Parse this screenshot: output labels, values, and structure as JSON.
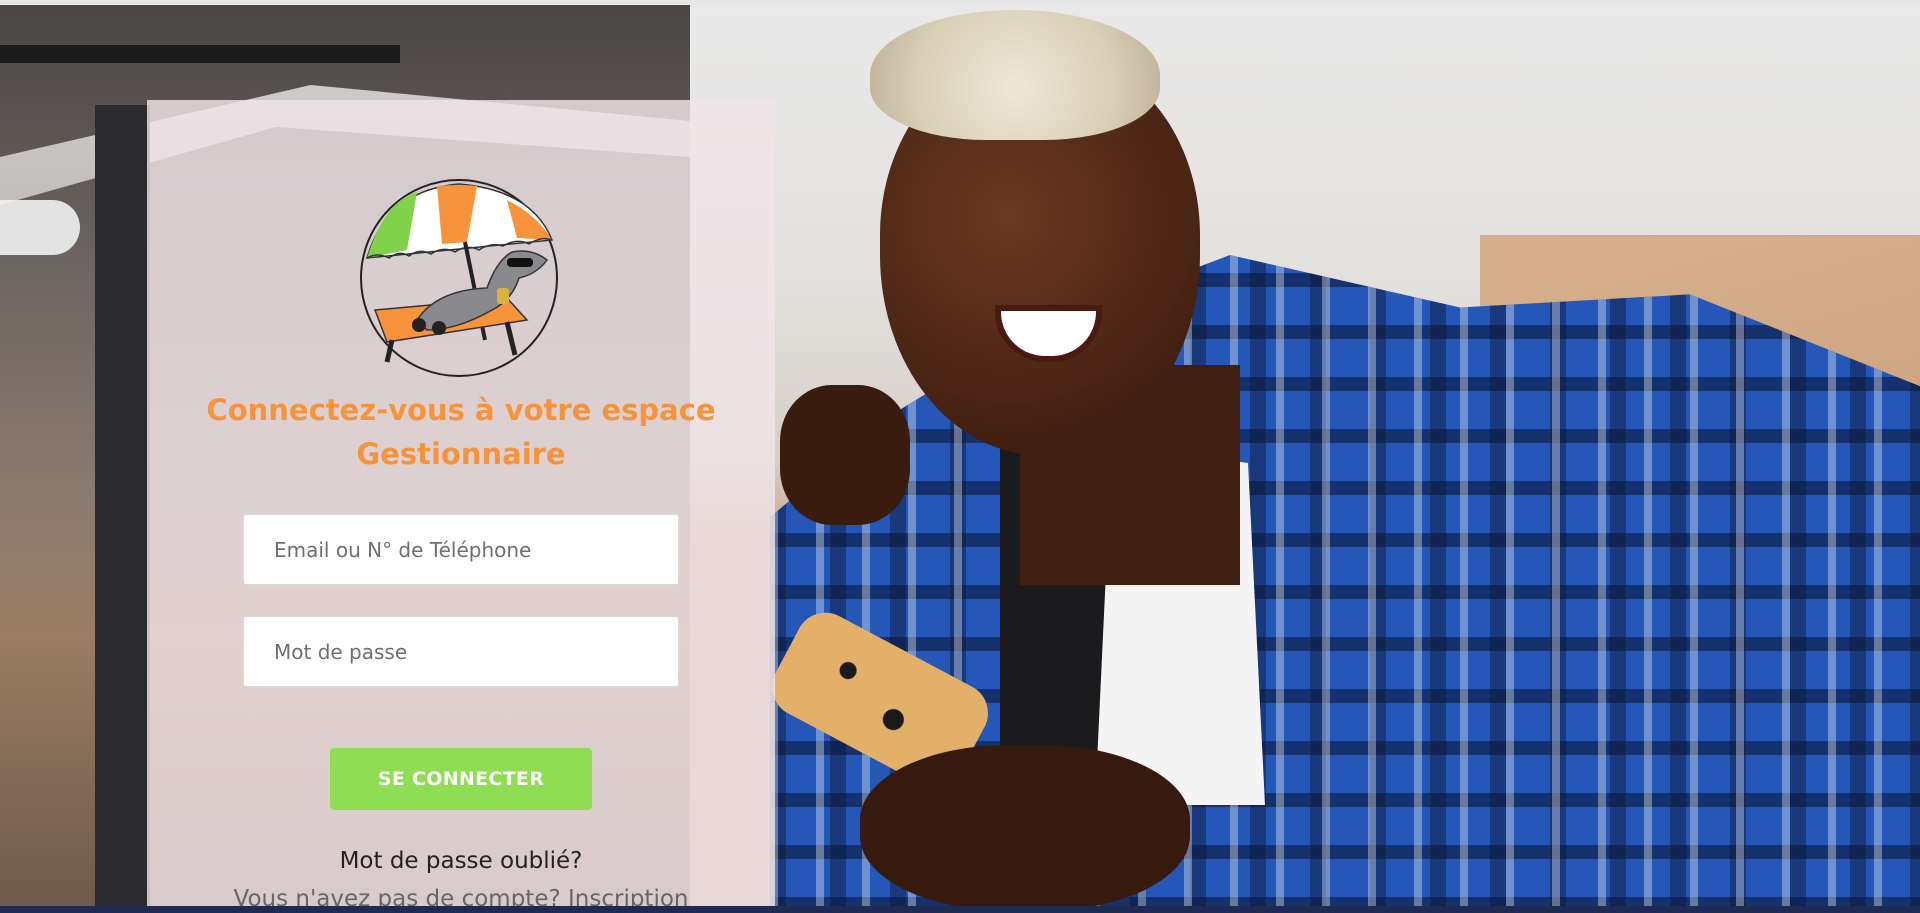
{
  "login": {
    "title_line1": "Connectez-vous à votre espace",
    "title_line2": "Gestionnaire",
    "email_placeholder": "Email ou N° de Téléphone",
    "password_placeholder": "Mot de passe",
    "submit_label": "SE CONNECTER",
    "forgot_label": "Mot de passe oublié?",
    "no_account_text": "Vous n'avez pas de compte?",
    "signup_label": "Inscription"
  },
  "colors": {
    "title": "#f7943b",
    "button": "#8fdd52",
    "panel": "#f0e4e8"
  },
  "icons": {
    "logo": "dog-under-beach-umbrella-logo"
  }
}
